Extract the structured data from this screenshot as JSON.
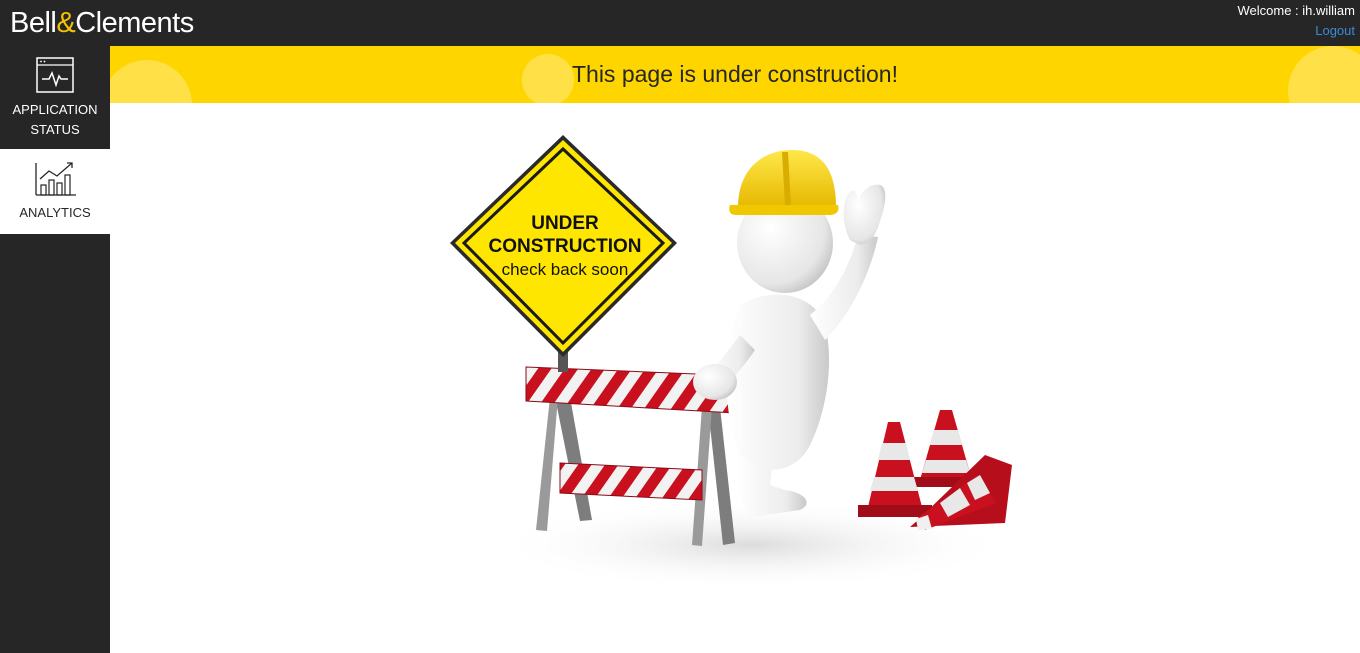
{
  "header": {
    "logo_left": "Bell",
    "logo_amp": "&",
    "logo_right": "Clements",
    "welcome": "Welcome : ih.william",
    "logout_label": "Logout"
  },
  "sidebar": {
    "items": [
      {
        "line1": "APPLICATION",
        "line2": "STATUS",
        "icon": "monitor-heartbeat-icon"
      },
      {
        "label": "ANALYTICS",
        "icon": "bar-chart-trend-icon"
      }
    ]
  },
  "banner": {
    "message": "This page is under construction!"
  },
  "illustration": {
    "sign_line1": "UNDER",
    "sign_line2": "CONSTRUCTION",
    "sign_line3": "check back soon"
  },
  "colors": {
    "topbar": "#262626",
    "banner": "#ffd500",
    "brand_amp": "#f5c400",
    "link": "#3b8bd9"
  }
}
